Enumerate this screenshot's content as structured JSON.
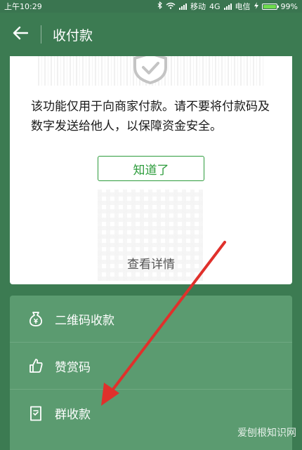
{
  "status_bar": {
    "time": "上午10:29",
    "carrier1": "移动",
    "network": "4G",
    "carrier2": "电信",
    "battery": "99%"
  },
  "header": {
    "title": "收付款",
    "back_icon": "arrow-left-icon"
  },
  "notice_card": {
    "message": "该功能仅用于向商家付款。请不要将付款码及数字发送给他人，以保障资金安全。",
    "confirm_label": "知道了",
    "details_label": "查看详情",
    "icon": "shield-check-icon"
  },
  "menu": {
    "items": [
      {
        "label": "二维码收款",
        "icon": "money-bag-icon"
      },
      {
        "label": "赞赏码",
        "icon": "thumbs-up-icon"
      },
      {
        "label": "群收款",
        "icon": "document-check-icon"
      }
    ]
  },
  "watermark": {
    "text": "爱刨根知识网"
  },
  "colors": {
    "header_green": "#3c7b52",
    "menu_green": "#5b9b70",
    "accent_green": "#2d9c3c",
    "annotation_red": "#e0302b"
  }
}
